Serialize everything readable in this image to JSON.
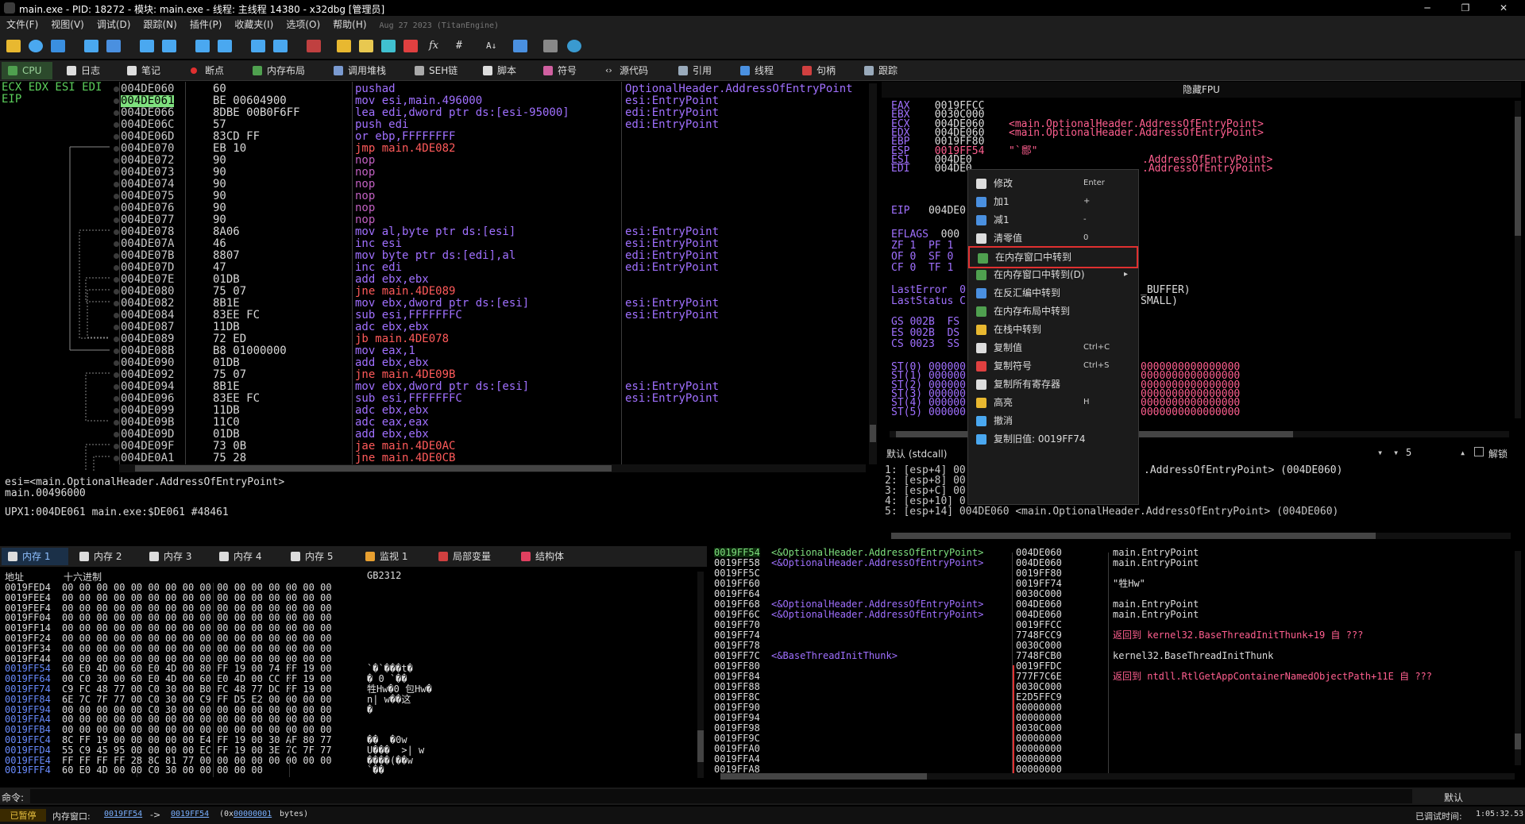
{
  "window": {
    "title": "main.exe - PID: 18272 - 模块: main.exe - 线程: 主线程 14380 - x32dbg [管理员]",
    "min": "─",
    "max": "❐",
    "close": "✕"
  },
  "menu": [
    "文件(F)",
    "视图(V)",
    "调试(D)",
    "跟踪(N)",
    "插件(P)",
    "收藏夹(I)",
    "选项(O)",
    "帮助(H)"
  ],
  "menu_date": "Aug 27 2023 (TitanEngine)",
  "tabs": [
    "CPU",
    "日志",
    "笔记",
    "断点",
    "内存布局",
    "调用堆栈",
    "SEH链",
    "脚本",
    "符号",
    "源代码",
    "引用",
    "线程",
    "句柄",
    "跟踪"
  ],
  "cpu": {
    "regs_label": [
      "ECX EDX ESI EDI",
      "EIP"
    ],
    "rows": [
      {
        "addr": "004DE060",
        "hex": "60",
        "dis": "pushad",
        "cmt": "OptionalHeader.AddressOfEntryPoint"
      },
      {
        "addr": "004DE061",
        "hex": "BE 00604900",
        "dis": "mov esi,main.496000",
        "cmt": "esi:EntryPoint"
      },
      {
        "addr": "004DE066",
        "hex": "8DBE 00B0F6FF",
        "dis": "lea edi,dword ptr ds:[esi-95000]",
        "cmt": "edi:EntryPoint"
      },
      {
        "addr": "004DE06C",
        "hex": "57",
        "dis": "push edi",
        "cmt": "edi:EntryPoint"
      },
      {
        "addr": "004DE06D",
        "hex": "83CD FF",
        "dis": "or ebp,FFFFFFFF",
        "cmt": ""
      },
      {
        "addr": "004DE070",
        "hex": "EB 10",
        "dis": "jmp main.4DE082",
        "cmt": ""
      },
      {
        "addr": "004DE072",
        "hex": "90",
        "dis": "nop",
        "cmt": ""
      },
      {
        "addr": "004DE073",
        "hex": "90",
        "dis": "nop",
        "cmt": ""
      },
      {
        "addr": "004DE074",
        "hex": "90",
        "dis": "nop",
        "cmt": ""
      },
      {
        "addr": "004DE075",
        "hex": "90",
        "dis": "nop",
        "cmt": ""
      },
      {
        "addr": "004DE076",
        "hex": "90",
        "dis": "nop",
        "cmt": ""
      },
      {
        "addr": "004DE077",
        "hex": "90",
        "dis": "nop",
        "cmt": ""
      },
      {
        "addr": "004DE078",
        "hex": "8A06",
        "dis": "mov al,byte ptr ds:[esi]",
        "cmt": "esi:EntryPoint"
      },
      {
        "addr": "004DE07A",
        "hex": "46",
        "dis": "inc esi",
        "cmt": "esi:EntryPoint"
      },
      {
        "addr": "004DE07B",
        "hex": "8807",
        "dis": "mov byte ptr ds:[edi],al",
        "cmt": "edi:EntryPoint"
      },
      {
        "addr": "004DE07D",
        "hex": "47",
        "dis": "inc edi",
        "cmt": "edi:EntryPoint"
      },
      {
        "addr": "004DE07E",
        "hex": "01DB",
        "dis": "add ebx,ebx",
        "cmt": ""
      },
      {
        "addr": "004DE080",
        "hex": "75 07",
        "dis": "jne main.4DE089",
        "cmt": ""
      },
      {
        "addr": "004DE082",
        "hex": "8B1E",
        "dis": "mov ebx,dword ptr ds:[esi]",
        "cmt": "esi:EntryPoint"
      },
      {
        "addr": "004DE084",
        "hex": "83EE FC",
        "dis": "sub esi,FFFFFFFC",
        "cmt": "esi:EntryPoint"
      },
      {
        "addr": "004DE087",
        "hex": "11DB",
        "dis": "adc ebx,ebx",
        "cmt": ""
      },
      {
        "addr": "004DE089",
        "hex": "72 ED",
        "dis": "jb main.4DE078",
        "cmt": ""
      },
      {
        "addr": "004DE08B",
        "hex": "B8 01000000",
        "dis": "mov eax,1",
        "cmt": ""
      },
      {
        "addr": "004DE090",
        "hex": "01DB",
        "dis": "add ebx,ebx",
        "cmt": ""
      },
      {
        "addr": "004DE092",
        "hex": "75 07",
        "dis": "jne main.4DE09B",
        "cmt": ""
      },
      {
        "addr": "004DE094",
        "hex": "8B1E",
        "dis": "mov ebx,dword ptr ds:[esi]",
        "cmt": "esi:EntryPoint"
      },
      {
        "addr": "004DE096",
        "hex": "83EE FC",
        "dis": "sub esi,FFFFFFFC",
        "cmt": "esi:EntryPoint"
      },
      {
        "addr": "004DE099",
        "hex": "11DB",
        "dis": "adc ebx,ebx",
        "cmt": ""
      },
      {
        "addr": "004DE09B",
        "hex": "11C0",
        "dis": "adc eax,eax",
        "cmt": ""
      },
      {
        "addr": "004DE09D",
        "hex": "01DB",
        "dis": "add ebx,ebx",
        "cmt": ""
      },
      {
        "addr": "004DE09F",
        "hex": "73 0B",
        "dis": "jae main.4DE0AC",
        "cmt": ""
      },
      {
        "addr": "004DE0A1",
        "hex": "75 28",
        "dis": "jne main.4DE0CB",
        "cmt": ""
      }
    ]
  },
  "info": [
    "esi=<main.OptionalHeader.AddressOfEntryPoint>",
    "main.00496000",
    "",
    "UPX1:004DE061 main.exe:$DE061 #48461"
  ],
  "regs": {
    "header": "隐藏FPU",
    "lines": [
      {
        "n": "EAX",
        "v": "0019FFCC",
        "c": ""
      },
      {
        "n": "EBX",
        "v": "0030C000",
        "c": ""
      },
      {
        "n": "ECX",
        "v": "004DE060",
        "c": "<main.OptionalHeader.AddressOfEntryPoint>"
      },
      {
        "n": "EDX",
        "v": "004DE060",
        "c": "<main.OptionalHeader.AddressOfEntryPoint>"
      },
      {
        "n": "EBP",
        "v": "0019FF80",
        "c": ""
      },
      {
        "n": "ESP",
        "v": "0019FF54",
        "c": "\"`郻\""
      },
      {
        "n": "ESI",
        "v": "004DE0",
        "c": ".AddressOfEntryPoint>"
      },
      {
        "n": "EDI",
        "v": "004DE0",
        "c": ".AddressOfEntryPoint>"
      }
    ],
    "eip": {
      "n": "EIP",
      "v": "004DE0"
    },
    "eflags": {
      "n": "EFLAGS",
      "v": "000"
    },
    "flags": [
      "ZF 1  PF 1",
      "OF 0  SF 0",
      "CF 0  TF 1"
    ],
    "lasterr": [
      "LastError  0",
      "LastStatus C"
    ],
    "lasterr_c": [
      "_BUFFER)",
      "SMALL)"
    ],
    "segs": [
      "GS 002B  FS",
      "ES 002B  DS",
      "CS 0023  SS"
    ],
    "st": [
      "ST(0) 000000",
      "ST(1) 000000",
      "ST(2) 000000",
      "ST(3) 000000",
      "ST(4) 000000",
      "ST(5) 000000"
    ],
    "st_c": "0000000000000000"
  },
  "callconv": {
    "label": "默认 (stdcall)",
    "count": "5",
    "unlock": "解锁"
  },
  "args": [
    "1: [esp+4] 00",
    "2: [esp+8] 00",
    "3: [esp+C] 00",
    "4: [esp+10] 0",
    "5: [esp+14] 004DE060 <main.OptionalHeader.AddressOfEntryPoint> (004DE060)"
  ],
  "args_c1": ".AddressOfEntryPoint> (004DE060)",
  "ctx": [
    {
      "label": "修改",
      "sc": "Enter"
    },
    {
      "label": "加1",
      "sc": "+"
    },
    {
      "label": "减1",
      "sc": "-"
    },
    {
      "label": "清零值",
      "sc": "0"
    },
    {
      "label": "在内存窗口中转到",
      "sc": ""
    },
    {
      "label": "在内存窗口中转到(D)",
      "sc": "▸"
    },
    {
      "label": "在反汇编中转到",
      "sc": ""
    },
    {
      "label": "在内存布局中转到",
      "sc": ""
    },
    {
      "label": "在栈中转到",
      "sc": ""
    },
    {
      "label": "复制值",
      "sc": "Ctrl+C"
    },
    {
      "label": "复制符号",
      "sc": "Ctrl+S"
    },
    {
      "label": "复制所有寄存器",
      "sc": ""
    },
    {
      "label": "高亮",
      "sc": "H"
    },
    {
      "label": "撤消",
      "sc": ""
    },
    {
      "label": "复制旧值: 0019FF74",
      "sc": ""
    }
  ],
  "dumptabs": [
    "内存 1",
    "内存 2",
    "内存 3",
    "内存 4",
    "内存 5",
    "监视 1",
    "局部变量",
    "结构体"
  ],
  "dump": {
    "hdr_addr": "地址",
    "hdr_hex": "十六进制",
    "hdr_enc": "GB2312",
    "rows": [
      {
        "a": "0019FED4",
        "h": "00 00 00 00 00 00 00 00 00 00 00 00 00 00 00 00",
        "t": ""
      },
      {
        "a": "0019FEE4",
        "h": "00 00 00 00 00 00 00 00 00 00 00 00 00 00 00 00",
        "t": ""
      },
      {
        "a": "0019FEF4",
        "h": "00 00 00 00 00 00 00 00 00 00 00 00 00 00 00 00",
        "t": ""
      },
      {
        "a": "0019FF04",
        "h": "00 00 00 00 00 00 00 00 00 00 00 00 00 00 00 00",
        "t": ""
      },
      {
        "a": "0019FF14",
        "h": "00 00 00 00 00 00 00 00 00 00 00 00 00 00 00 00",
        "t": ""
      },
      {
        "a": "0019FF24",
        "h": "00 00 00 00 00 00 00 00 00 00 00 00 00 00 00 00",
        "t": ""
      },
      {
        "a": "0019FF34",
        "h": "00 00 00 00 00 00 00 00 00 00 00 00 00 00 00 00",
        "t": ""
      },
      {
        "a": "0019FF44",
        "h": "00 00 00 00 00 00 00 00 00 00 00 00 00 00 00 00",
        "t": ""
      },
      {
        "a": "0019FF54",
        "h": "60 E0 4D 00 60 E0 4D 00 80 FF 19 00 74 FF 19 00",
        "t": "`�`���t�"
      },
      {
        "a": "0019FF64",
        "h": "00 C0 30 00 60 E0 4D 00 60 E0 4D 00 CC FF 19 00",
        "t": "� 0 `��"
      },
      {
        "a": "0019FF74",
        "h": "C9 FC 48 77 00 C0 30 00 B0 FC 48 77 DC FF 19 00",
        "t": "牲Hw�0 包Hw�"
      },
      {
        "a": "0019FF84",
        "h": "6E 7C 7F 77 00 C0 30 00 C9 FF D5 E2 00 00 00 00",
        "t": "n| w��这"
      },
      {
        "a": "0019FF94",
        "h": "00 00 00 00 00 C0 30 00 00 00 00 00 00 00 00 00",
        "t": "�"
      },
      {
        "a": "0019FFA4",
        "h": "00 00 00 00 00 00 00 00 00 00 00 00 00 00 00 00",
        "t": ""
      },
      {
        "a": "0019FFB4",
        "h": "00 00 00 00 00 00 00 00 00 00 00 00 00 00 00 00",
        "t": ""
      },
      {
        "a": "0019FFC4",
        "h": "8C FF 19 00 00 00 00 00 E4 FF 19 00 30 AF 80 77",
        "t": "��  �0w"
      },
      {
        "a": "0019FFD4",
        "h": "55 C9 45 95 00 00 00 00 EC FF 19 00 3E 7C 7F 77",
        "t": "U���  >| w"
      },
      {
        "a": "0019FFE4",
        "h": "FF FF FF FF 28 8C 81 77 00 00 00 00 00 00 00 00",
        "t": "����(��w"
      },
      {
        "a": "0019FFF4",
        "h": "60 E0 4D 00 00 C0 30 00 00 00 00 00",
        "t": "`��"
      }
    ]
  },
  "stack": {
    "rows": [
      {
        "a": "0019FF54",
        "c": "<&OptionalHeader.AddressOfEntryPoint>",
        "v": "004DE060",
        "r": "main.EntryPoint"
      },
      {
        "a": "0019FF58",
        "c": "<&OptionalHeader.AddressOfEntryPoint>",
        "v": "004DE060",
        "r": "main.EntryPoint"
      },
      {
        "a": "0019FF5C",
        "c": "",
        "v": "0019FF80",
        "r": ""
      },
      {
        "a": "0019FF60",
        "c": "",
        "v": "0019FF74",
        "r": "\"牲Hw\""
      },
      {
        "a": "0019FF64",
        "c": "",
        "v": "0030C000",
        "r": ""
      },
      {
        "a": "0019FF68",
        "c": "<&OptionalHeader.AddressOfEntryPoint>",
        "v": "004DE060",
        "r": "main.EntryPoint"
      },
      {
        "a": "0019FF6C",
        "c": "<&OptionalHeader.AddressOfEntryPoint>",
        "v": "004DE060",
        "r": "main.EntryPoint"
      },
      {
        "a": "0019FF70",
        "c": "",
        "v": "0019FFCC",
        "r": ""
      },
      {
        "a": "0019FF74",
        "c": "",
        "v": "7748FCC9",
        "r": "返回到 kernel32.BaseThreadInitThunk+19 自 ???"
      },
      {
        "a": "0019FF78",
        "c": "",
        "v": "0030C000",
        "r": ""
      },
      {
        "a": "0019FF7C",
        "c": "<&BaseThreadInitThunk>",
        "v": "7748FCB0",
        "r": "kernel32.BaseThreadInitThunk"
      },
      {
        "a": "0019FF80",
        "c": "",
        "v": "0019FFDC",
        "r": ""
      },
      {
        "a": "0019FF84",
        "c": "",
        "v": "777F7C6E",
        "r": "返回到 ntdll.RtlGetAppContainerNamedObjectPath+11E 自 ???"
      },
      {
        "a": "0019FF88",
        "c": "",
        "v": "0030C000",
        "r": ""
      },
      {
        "a": "0019FF8C",
        "c": "",
        "v": "E2D5FFC9",
        "r": ""
      },
      {
        "a": "0019FF90",
        "c": "",
        "v": "00000000",
        "r": ""
      },
      {
        "a": "0019FF94",
        "c": "",
        "v": "00000000",
        "r": ""
      },
      {
        "a": "0019FF98",
        "c": "",
        "v": "0030C000",
        "r": ""
      },
      {
        "a": "0019FF9C",
        "c": "",
        "v": "00000000",
        "r": ""
      },
      {
        "a": "0019FFA0",
        "c": "",
        "v": "00000000",
        "r": ""
      },
      {
        "a": "0019FFA4",
        "c": "",
        "v": "00000000",
        "r": ""
      },
      {
        "a": "0019FFA8",
        "c": "",
        "v": "00000000",
        "r": ""
      }
    ]
  },
  "cmd": {
    "label": "命令:",
    "default": "默认"
  },
  "status": {
    "paused": "已暂停",
    "memwin": "内存窗口:",
    "from": "0019FF54",
    "arrow": "->",
    "to": "0019FF54",
    "size_pre": "(0x",
    "size": "00000001",
    "size_post": "bytes)",
    "time_label": "已调试时间:",
    "time": "1:05:32.53"
  }
}
